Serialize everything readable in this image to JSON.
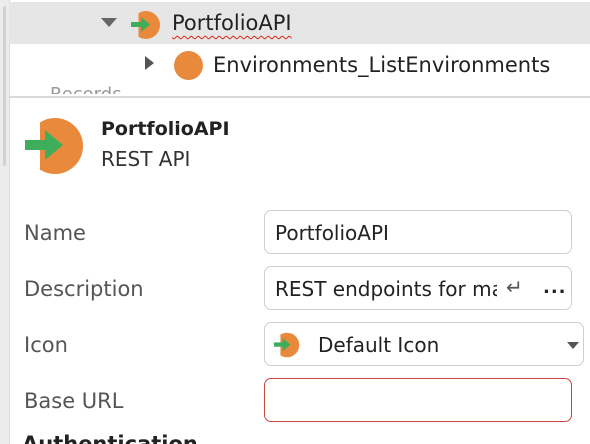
{
  "tree": {
    "selected_node": {
      "label": "PortfolioAPI",
      "icon": "rest-api-icon"
    },
    "child_node": {
      "label": "Environments_ListEnvironments",
      "icon": "orange-circle-icon"
    },
    "cut_off_label": "Records"
  },
  "properties": {
    "header": {
      "name": "PortfolioAPI",
      "type": "REST API",
      "icon": "rest-api-icon"
    },
    "rows": {
      "name": {
        "label": "Name",
        "value": "PortfolioAPI"
      },
      "description": {
        "label": "Description",
        "value": "REST endpoints for managing portfolios",
        "return_glyph": "↵",
        "ellipsis": "..."
      },
      "icon": {
        "label": "Icon",
        "value": "Default Icon",
        "icon": "rest-api-icon"
      },
      "base_url": {
        "label": "Base URL",
        "value": ""
      }
    },
    "next_section": "Authentication"
  },
  "colors": {
    "icon_orange": "#e8893b",
    "icon_green": "#3fae5a",
    "error_border": "#c9483d",
    "selected_row": "#e6e6e6"
  }
}
